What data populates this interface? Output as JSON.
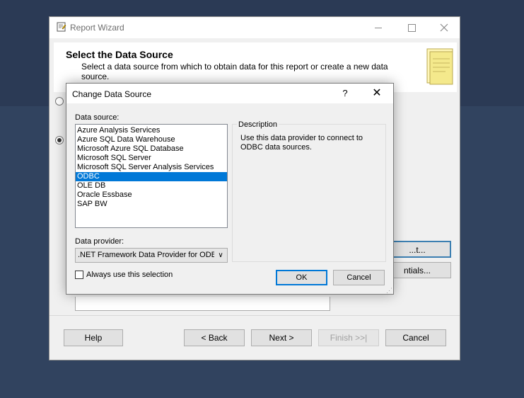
{
  "wizard": {
    "title": "Report Wizard",
    "heading": "Select the Data Source",
    "subtext": "Select a data source from which to obtain data for this report or create a new data source.",
    "background_buttons": {
      "edit_label": "...t...",
      "credentials_label": "ntials..."
    },
    "nav": {
      "help": "Help",
      "back": "< Back",
      "next": "Next >",
      "finish": "Finish >>|",
      "cancel": "Cancel"
    }
  },
  "dialog": {
    "title": "Change Data Source",
    "help_glyph": "?",
    "close_glyph": "✕",
    "data_source_label": "Data source:",
    "data_sources": [
      "Azure Analysis Services",
      "Azure SQL Data Warehouse",
      "Microsoft Azure SQL Database",
      "Microsoft SQL Server",
      "Microsoft SQL Server Analysis Services",
      "ODBC",
      "OLE DB",
      "Oracle Essbase",
      "SAP BW"
    ],
    "selected_index": 5,
    "description_label": "Description",
    "description_text": "Use this data provider to connect to ODBC data sources.",
    "data_provider_label": "Data provider:",
    "data_provider_value": ".NET Framework Data Provider for ODBC",
    "always_use_label": "Always use this selection",
    "always_use_checked": false,
    "ok_label": "OK",
    "cancel_label": "Cancel"
  },
  "colors": {
    "desktop_top": "#2b3a55",
    "desktop_bottom": "#31435f",
    "selection": "#0078d7",
    "dialog_bg": "#f0f0f0"
  }
}
